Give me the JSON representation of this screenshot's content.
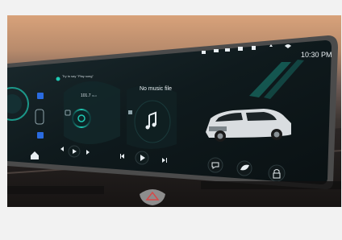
{
  "status_bar": {
    "voice_prompt": "Try to say \"Play song\"",
    "time": "10:30 PM",
    "icons": [
      "bluetooth-icon",
      "signal-icon",
      "wifi-icon",
      "car-status-icon",
      "user-icon",
      "phone-icon",
      "network-icon"
    ]
  },
  "radio": {
    "frequency": "101.7",
    "unit": "MHz"
  },
  "music": {
    "title": "No music file"
  },
  "colors": {
    "accent_teal": "#1fc9b3",
    "screen_dark": "#0d1416",
    "bezel": "#3a3a3a",
    "text_light": "#e8eef2"
  },
  "icons": {
    "home": "home-icon",
    "prev": "skip-back-icon",
    "play": "play-icon",
    "next": "skip-forward-icon",
    "radio_dial": "radio-dial-icon",
    "note": "music-note-icon",
    "chat": "chat-icon",
    "drive_mode": "leaf-icon",
    "lock": "lock-icon",
    "hazard": "hazard-icon"
  }
}
